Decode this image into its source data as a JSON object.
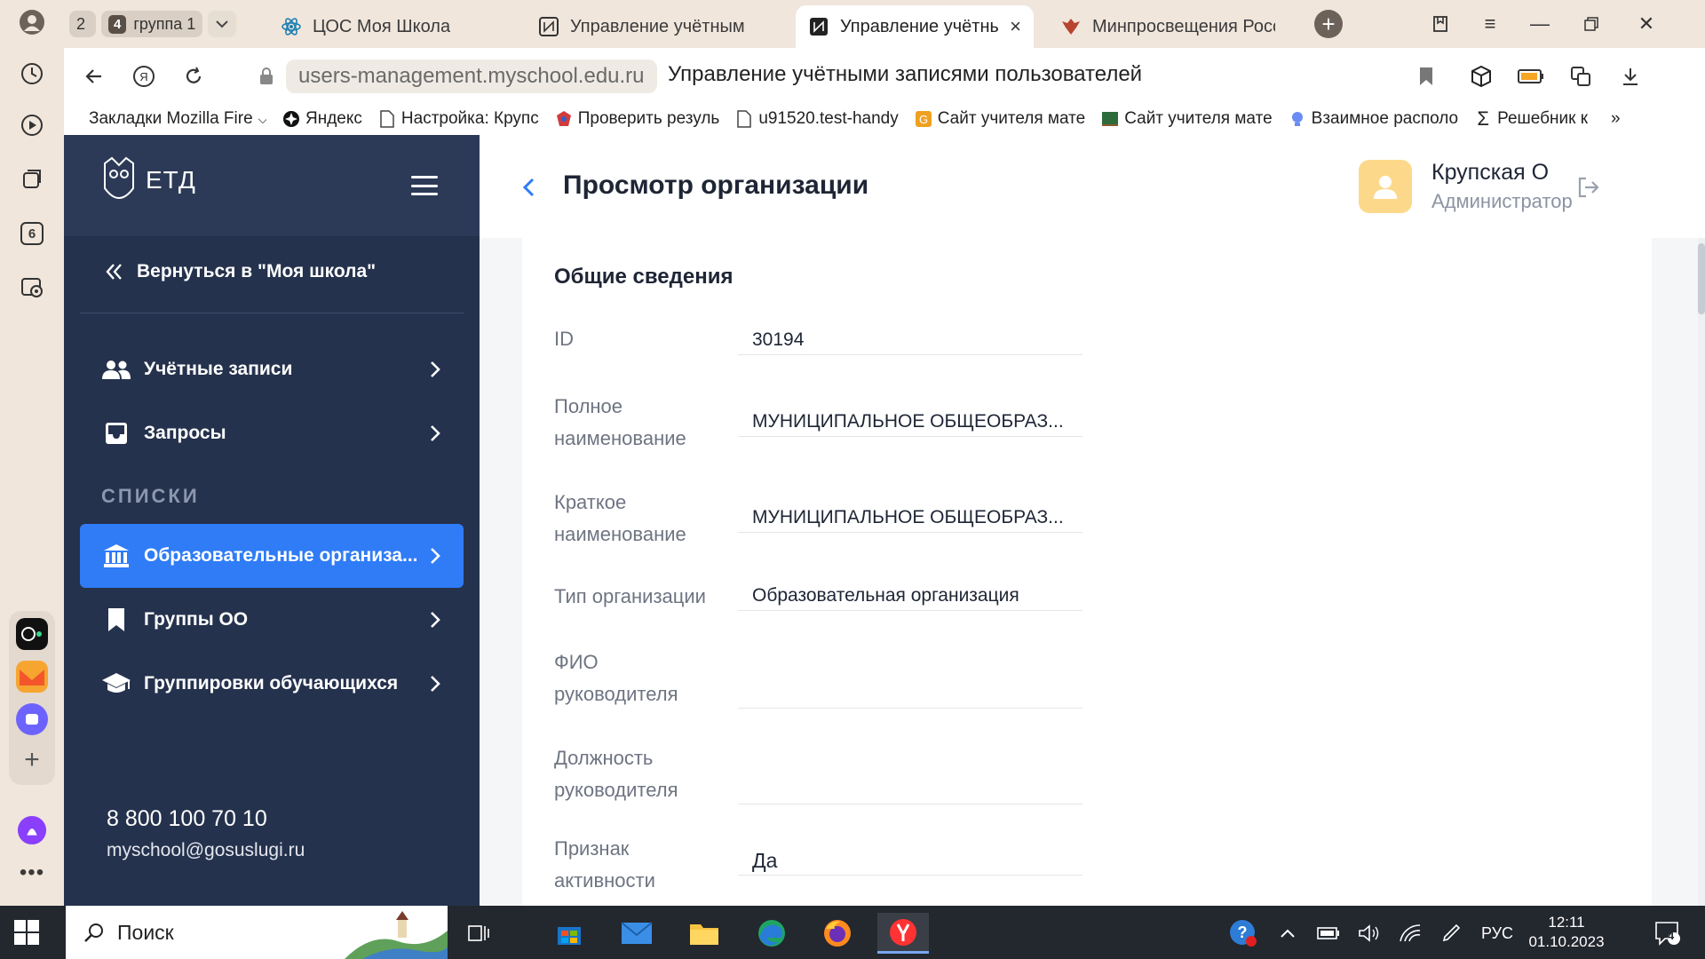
{
  "browser": {
    "tab_group": {
      "count_badge": "2",
      "group_badge": "4",
      "group_label": "группа 1"
    },
    "tabs": [
      {
        "label": "ЦОС Моя Школа",
        "icon": "react-atom-icon",
        "active": false
      },
      {
        "label": "Управление учётными за",
        "icon": "eta-owl-icon",
        "active": false
      },
      {
        "label": "Управление учётными",
        "icon": "eta-owl-icon",
        "active": true
      },
      {
        "label": "Минпросвещения Росси",
        "icon": "eagle-emblem-icon",
        "active": false
      }
    ],
    "url": "users-management.myschool.edu.ru",
    "page_title": "Управление учётными записями пользователей",
    "bookmarks": [
      {
        "label": "Закладки Mozilla Fire",
        "icon": "folder-chevron-icon"
      },
      {
        "label": "Яндекс",
        "icon": "yandex-star-icon"
      },
      {
        "label": "Настройка: Крупс",
        "icon": "document-icon"
      },
      {
        "label": "Проверить резуль",
        "icon": "emblem-icon"
      },
      {
        "label": "u91520.test-handy",
        "icon": "document-icon"
      },
      {
        "label": "Сайт учителя мате",
        "icon": "site-icon"
      },
      {
        "label": "Сайт учителя мате",
        "icon": "chalkboard-icon"
      },
      {
        "label": "Взаимное располо",
        "icon": "bulb-icon"
      },
      {
        "label": "Решебник к",
        "icon": "sigma-icon"
      }
    ],
    "side_badge": "6"
  },
  "app": {
    "logo_text": "ЕТД",
    "back_label": "Вернуться в \"Моя школа\"",
    "nav": [
      {
        "label": "Учётные записи",
        "icon": "users-icon",
        "active": false
      },
      {
        "label": "Запросы",
        "icon": "inbox-icon",
        "active": false
      }
    ],
    "section_label": "СПИСКИ",
    "lists": [
      {
        "label": "Образовательные организа...",
        "icon": "institution-icon",
        "active": true
      },
      {
        "label": "Группы ОО",
        "icon": "bookmark-icon",
        "active": false
      },
      {
        "label": "Группировки обучающихся",
        "icon": "graduation-cap-icon",
        "active": false
      }
    ],
    "contact": {
      "phone": "8 800 100 70 10",
      "email": "myschool@gosuslugi.ru"
    }
  },
  "main": {
    "title": "Просмотр организации",
    "user": {
      "name": "Крупская О",
      "role": "Администратор"
    },
    "card_title": "Общие сведения",
    "fields": [
      {
        "label": "ID",
        "value": "30194"
      },
      {
        "label": "Полное наименование",
        "value": "МУНИЦИПАЛЬНОЕ ОБЩЕОБРАЗ..."
      },
      {
        "label": "Краткое наименование",
        "value": "МУНИЦИПАЛЬНОЕ ОБЩЕОБРАЗ..."
      },
      {
        "label": "Тип организации",
        "value": "Образовательная организация"
      },
      {
        "label": "ФИО руководителя",
        "value": ""
      },
      {
        "label": "Должность руководителя",
        "value": ""
      },
      {
        "label": "Признак активности",
        "value": "Да"
      }
    ]
  },
  "taskbar": {
    "search_placeholder": "Поиск",
    "language": "РУС",
    "time": "12:11",
    "date": "01.10.2023",
    "notifications": "4"
  },
  "colors": {
    "sidebar_bg": "#2c3a57",
    "active_nav": "#2f7cf6",
    "avatar_bg": "#fcd98a"
  }
}
